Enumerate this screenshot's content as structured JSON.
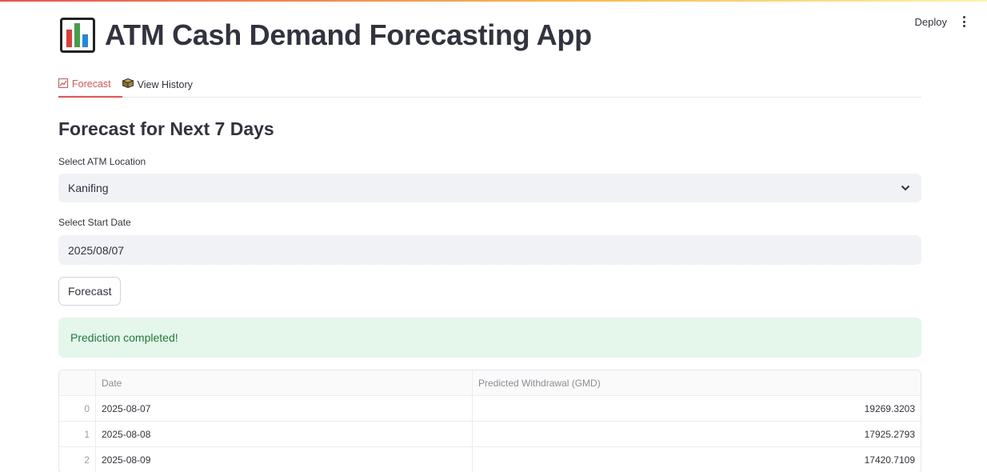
{
  "header": {
    "deploy_label": "Deploy",
    "title": "ATM Cash Demand Forecasting App",
    "title_icon": "bar-chart-emoji"
  },
  "tabs": [
    {
      "label": "Forecast",
      "icon": "chart-increasing-emoji",
      "active": true
    },
    {
      "label": "View History",
      "icon": "package-emoji",
      "active": false
    }
  ],
  "section_title": "Forecast for Next 7 Days",
  "location": {
    "label": "Select ATM Location",
    "value": "Kanifing"
  },
  "start_date": {
    "label": "Select Start Date",
    "value": "2025/08/07"
  },
  "forecast_button_label": "Forecast",
  "alert_text": "Prediction completed!",
  "table": {
    "columns": [
      "",
      "Date",
      "Predicted Withdrawal (GMD)"
    ],
    "rows": [
      {
        "index": "0",
        "date": "2025-08-07",
        "value": "19269.3203"
      },
      {
        "index": "1",
        "date": "2025-08-08",
        "value": "17925.2793"
      },
      {
        "index": "2",
        "date": "2025-08-09",
        "value": "17420.7109"
      }
    ]
  },
  "colors": {
    "accent": "#ff4b4b",
    "success_bg": "#e5f6eb",
    "success_text": "#1e7a3a",
    "input_bg": "#f0f2f6"
  }
}
